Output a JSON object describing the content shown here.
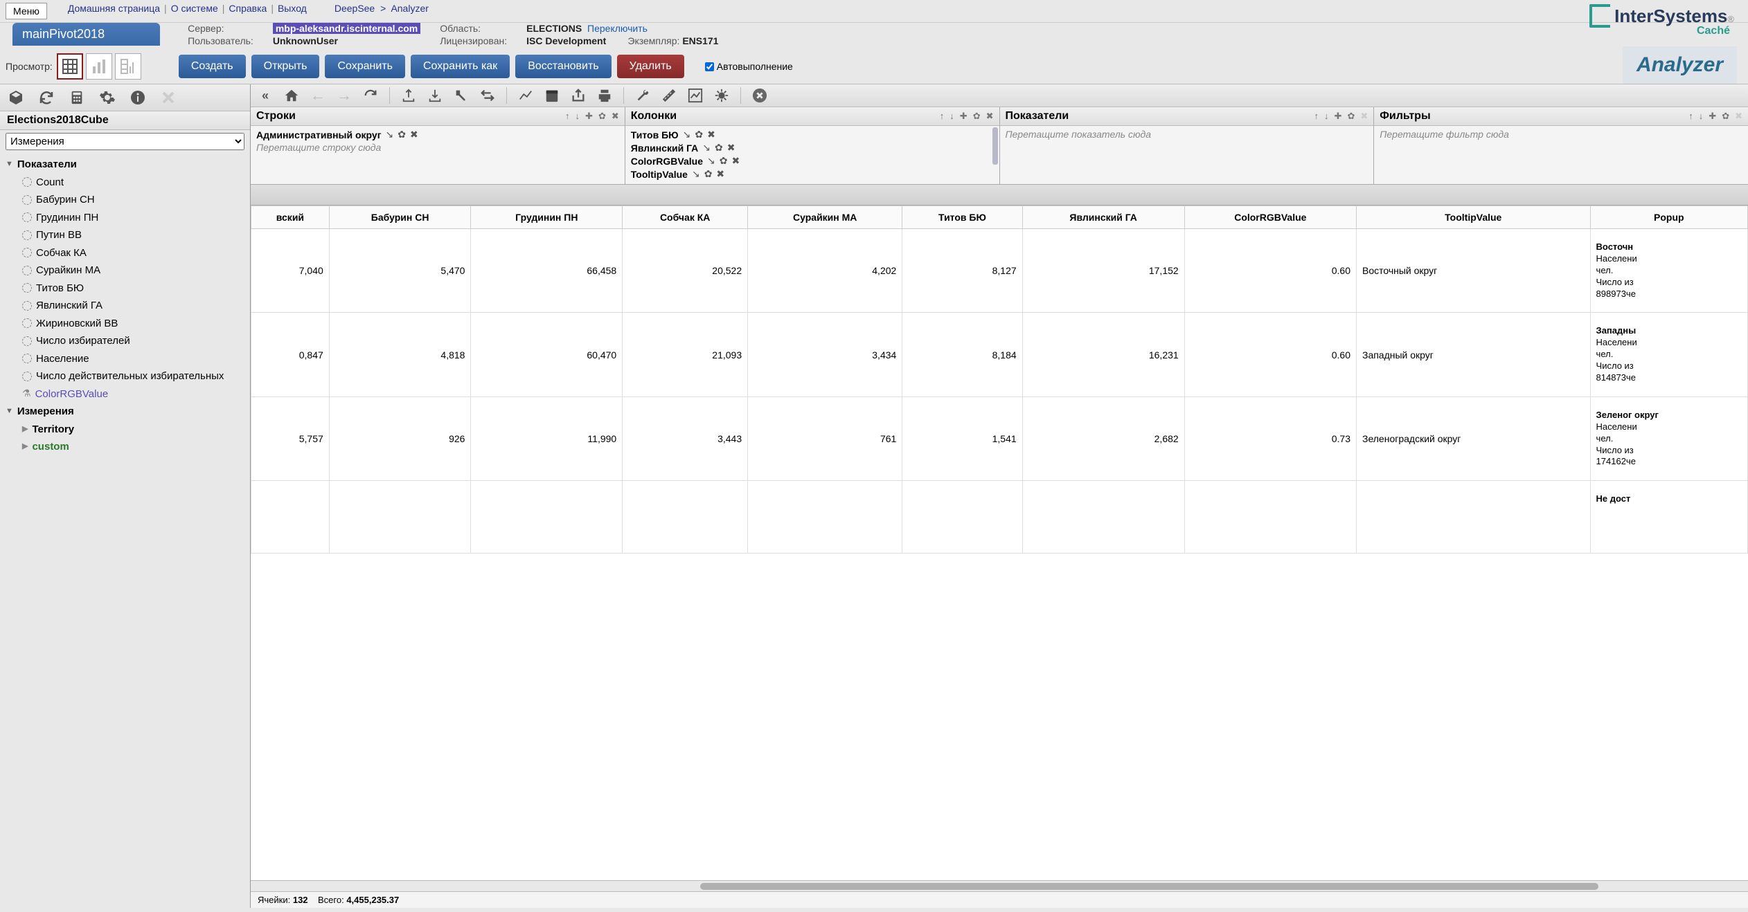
{
  "menu": "Меню",
  "links": {
    "home": "Домашняя страница",
    "about": "О системе",
    "help": "Справка",
    "exit": "Выход"
  },
  "breadcrumb": {
    "root": "DeepSee",
    "page": "Analyzer"
  },
  "title": "mainPivot2018",
  "info": {
    "server_lbl": "Сервер:",
    "server_val": "mbp-aleksandr.iscinternal.com",
    "user_lbl": "Пользователь:",
    "user_val": "UnknownUser",
    "area_lbl": "Область:",
    "area_val": "ELECTIONS",
    "area_switch": "Переключить",
    "lic_lbl": "Лицензирован:",
    "lic_val": "ISC Development",
    "inst_lbl": "Экземпляр:",
    "inst_val": "ENS171"
  },
  "logo": {
    "brand": "InterSystems",
    "sub": "Caché"
  },
  "view_lbl": "Просмотр:",
  "actions": {
    "create": "Создать",
    "open": "Открыть",
    "save": "Сохранить",
    "saveas": "Сохранить как",
    "restore": "Восстановить",
    "delete": "Удалить"
  },
  "autoexec": "Автовыполнение",
  "analyzer": "Analyzer",
  "cube": "Elections2018Cube",
  "dim_select": "Измерения",
  "tree": {
    "measures_hdr": "Показатели",
    "measures": [
      "Count",
      "Бабурин СН",
      "Грудинин ПН",
      "Путин ВВ",
      "Собчак КА",
      "Сурайкин МА",
      "Титов БЮ",
      "Явлинский ГА",
      "Жириновский ВВ",
      "Число избирателей",
      "Население",
      "Число действительных избирательных"
    ],
    "calc": "ColorRGBValue",
    "dims_hdr": "Измерения",
    "dims": [
      {
        "name": "Territory",
        "cls": "bold"
      },
      {
        "name": "custom",
        "cls": "green"
      }
    ]
  },
  "zones": {
    "rows": {
      "title": "Строки",
      "item": "Административный округ",
      "placeholder": "Перетащите строку сюда"
    },
    "cols": {
      "title": "Колонки",
      "items": [
        "Титов БЮ",
        "Явлинский ГА",
        "ColorRGBValue",
        "TooltipValue"
      ]
    },
    "meas": {
      "title": "Показатели",
      "placeholder": "Перетащите показатель сюда"
    },
    "filt": {
      "title": "Фильтры",
      "placeholder": "Перетащите фильтр сюда"
    }
  },
  "table": {
    "headers": [
      "вский",
      "Бабурин СН",
      "Грудинин ПН",
      "Собчак КА",
      "Сурайкин МА",
      "Титов БЮ",
      "Явлинский ГА",
      "ColorRGBValue",
      "TooltipValue",
      "Popup"
    ],
    "rows": [
      {
        "vals": [
          "7,040",
          "5,470",
          "66,458",
          "20,522",
          "4,202",
          "8,127",
          "17,152",
          "0.60",
          "Восточный округ"
        ],
        "popup": {
          "b": "Восточн",
          "l1": "Населени",
          "l2": "чел.",
          "l3": "Число из",
          "l4": "898973че"
        }
      },
      {
        "vals": [
          "0,847",
          "4,818",
          "60,470",
          "21,093",
          "3,434",
          "8,184",
          "16,231",
          "0.60",
          "Западный округ"
        ],
        "popup": {
          "b": "Западны",
          "l1": "Населени",
          "l2": "чел.",
          "l3": "Число из",
          "l4": "814873че"
        }
      },
      {
        "vals": [
          "5,757",
          "926",
          "11,990",
          "3,443",
          "761",
          "1,541",
          "2,682",
          "0.73",
          "Зеленоградский округ"
        ],
        "popup": {
          "b": "Зеленог округ",
          "l1": "Населени",
          "l2": "чел.",
          "l3": "Число из",
          "l4": "174162че"
        }
      },
      {
        "vals": [
          "",
          "",
          "",
          "",
          "",
          "",
          "",
          "",
          ""
        ],
        "popup": {
          "b": "Не дост",
          "l1": "",
          "l2": "",
          "l3": "",
          "l4": ""
        }
      }
    ]
  },
  "status": {
    "cells_lbl": "Ячейки:",
    "cells": "132",
    "total_lbl": "Всего:",
    "total": "4,455,235.37"
  }
}
